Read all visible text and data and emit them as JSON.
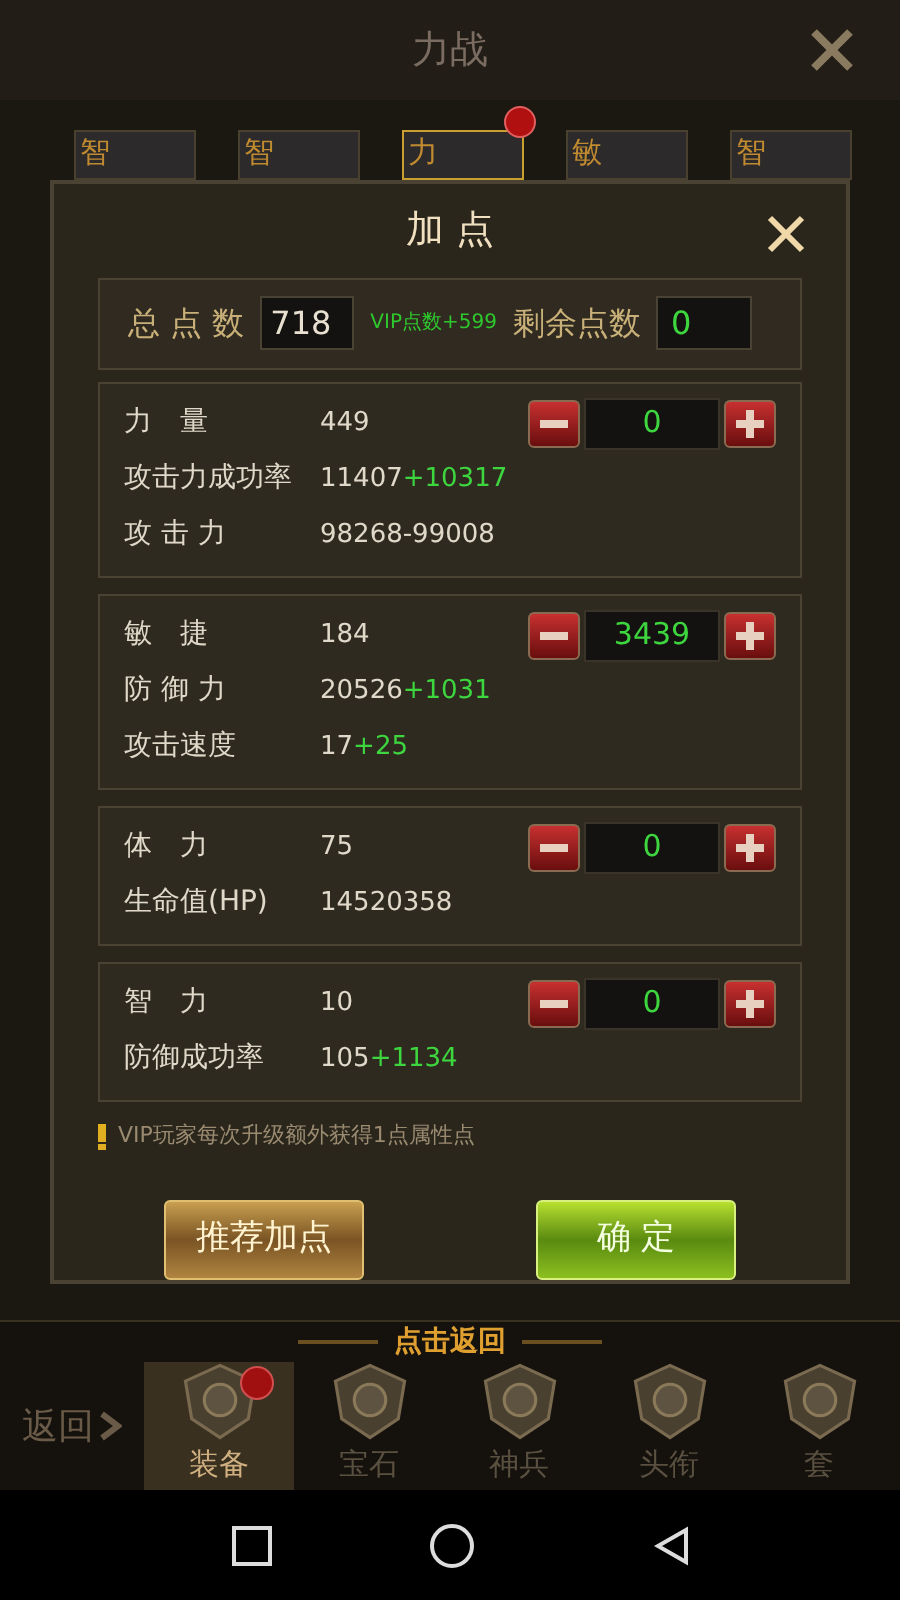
{
  "header": {
    "title": "力战"
  },
  "hero_tabs": [
    {
      "label": "智",
      "selected": false,
      "dot": false
    },
    {
      "label": "智",
      "selected": false,
      "dot": false
    },
    {
      "label": "力",
      "selected": true,
      "dot": true
    },
    {
      "label": "敏",
      "selected": false,
      "dot": false
    },
    {
      "label": "智",
      "selected": false,
      "dot": false
    }
  ],
  "dialog": {
    "title": "加 点",
    "summary": {
      "total_label": "总 点 数",
      "total_value": "718",
      "vip_bonus": "VIP点数+599",
      "remaining_label": "剩余点数",
      "remaining_value": "0"
    },
    "groups": [
      {
        "stepper_value": "0",
        "rows": [
          {
            "label": "力　量",
            "value": "449"
          },
          {
            "label": "攻击力成功率",
            "value": "11407",
            "bonus": "+10317"
          },
          {
            "label": "攻 击 力",
            "value": "98268-99008"
          }
        ]
      },
      {
        "stepper_value": "3439",
        "rows": [
          {
            "label": "敏　捷",
            "value": "184"
          },
          {
            "label": "防 御 力",
            "value": "20526",
            "bonus": "+1031"
          },
          {
            "label": "攻击速度",
            "value": "17",
            "bonus": "+25"
          }
        ]
      },
      {
        "stepper_value": "0",
        "rows": [
          {
            "label": "体　力",
            "value": "75"
          },
          {
            "label": "生命值(HP)",
            "value": "14520358"
          }
        ]
      },
      {
        "stepper_value": "0",
        "rows": [
          {
            "label": "智　力",
            "value": "10"
          },
          {
            "label": "防御成功率",
            "value": "105",
            "bonus": "+1134"
          }
        ]
      }
    ],
    "note": "VIP玩家每次升级额外获得1点属性点",
    "buttons": [
      {
        "label": "推荐加点",
        "kind": "gold"
      },
      {
        "label": "确 定",
        "kind": "green"
      }
    ]
  },
  "bottom_bar": {
    "back_label": "返回",
    "banner": "点击返回",
    "tabs": [
      {
        "label": "装备",
        "selected": true,
        "dot": true
      },
      {
        "label": "宝石",
        "selected": false,
        "dot": false
      },
      {
        "label": "神兵",
        "selected": false,
        "dot": false
      },
      {
        "label": "头衔",
        "selected": false,
        "dot": false
      },
      {
        "label": "套",
        "selected": false,
        "dot": false
      }
    ]
  }
}
